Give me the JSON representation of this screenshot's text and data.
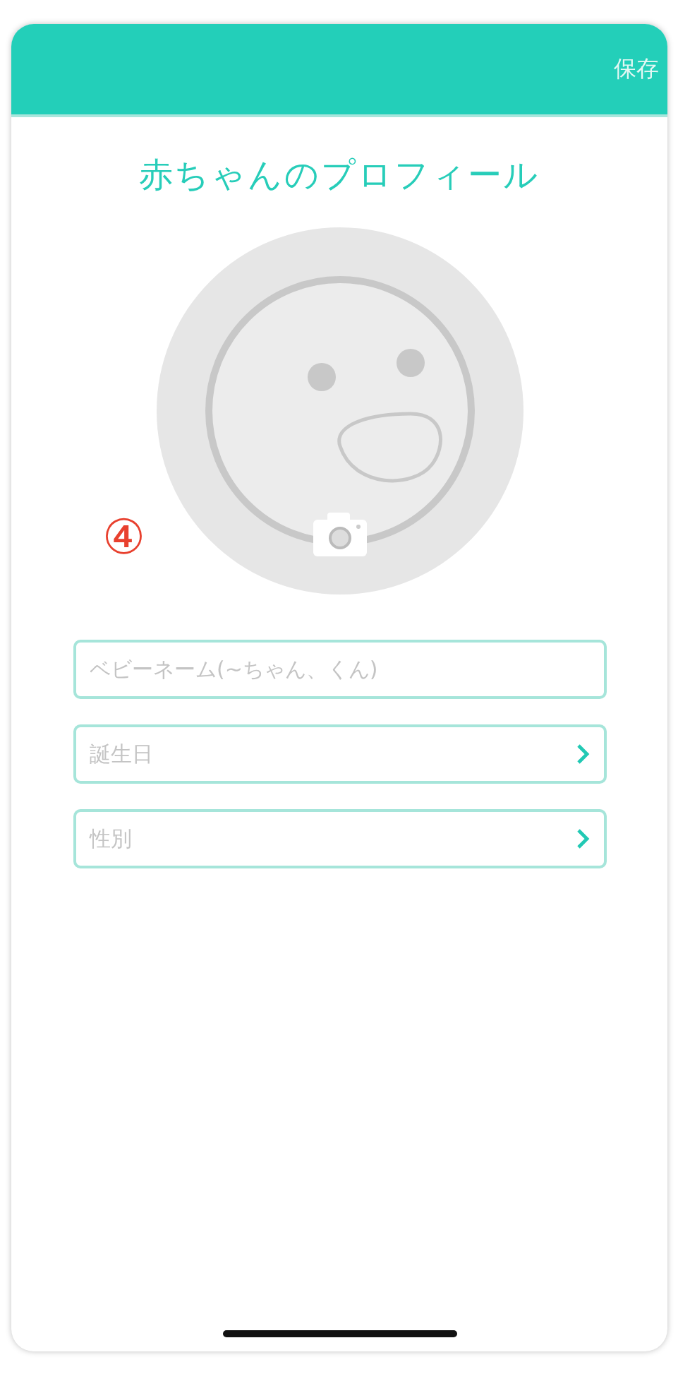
{
  "header": {
    "save_label": "保存"
  },
  "title": "赤ちゃんのプロフィール",
  "annotation": "④",
  "fields": [
    {
      "kind": "text",
      "placeholder": "ベビーネーム(~ちゃん、くん)"
    },
    {
      "kind": "select",
      "placeholder": "誕生日"
    },
    {
      "kind": "select",
      "placeholder": "性別"
    }
  ]
}
